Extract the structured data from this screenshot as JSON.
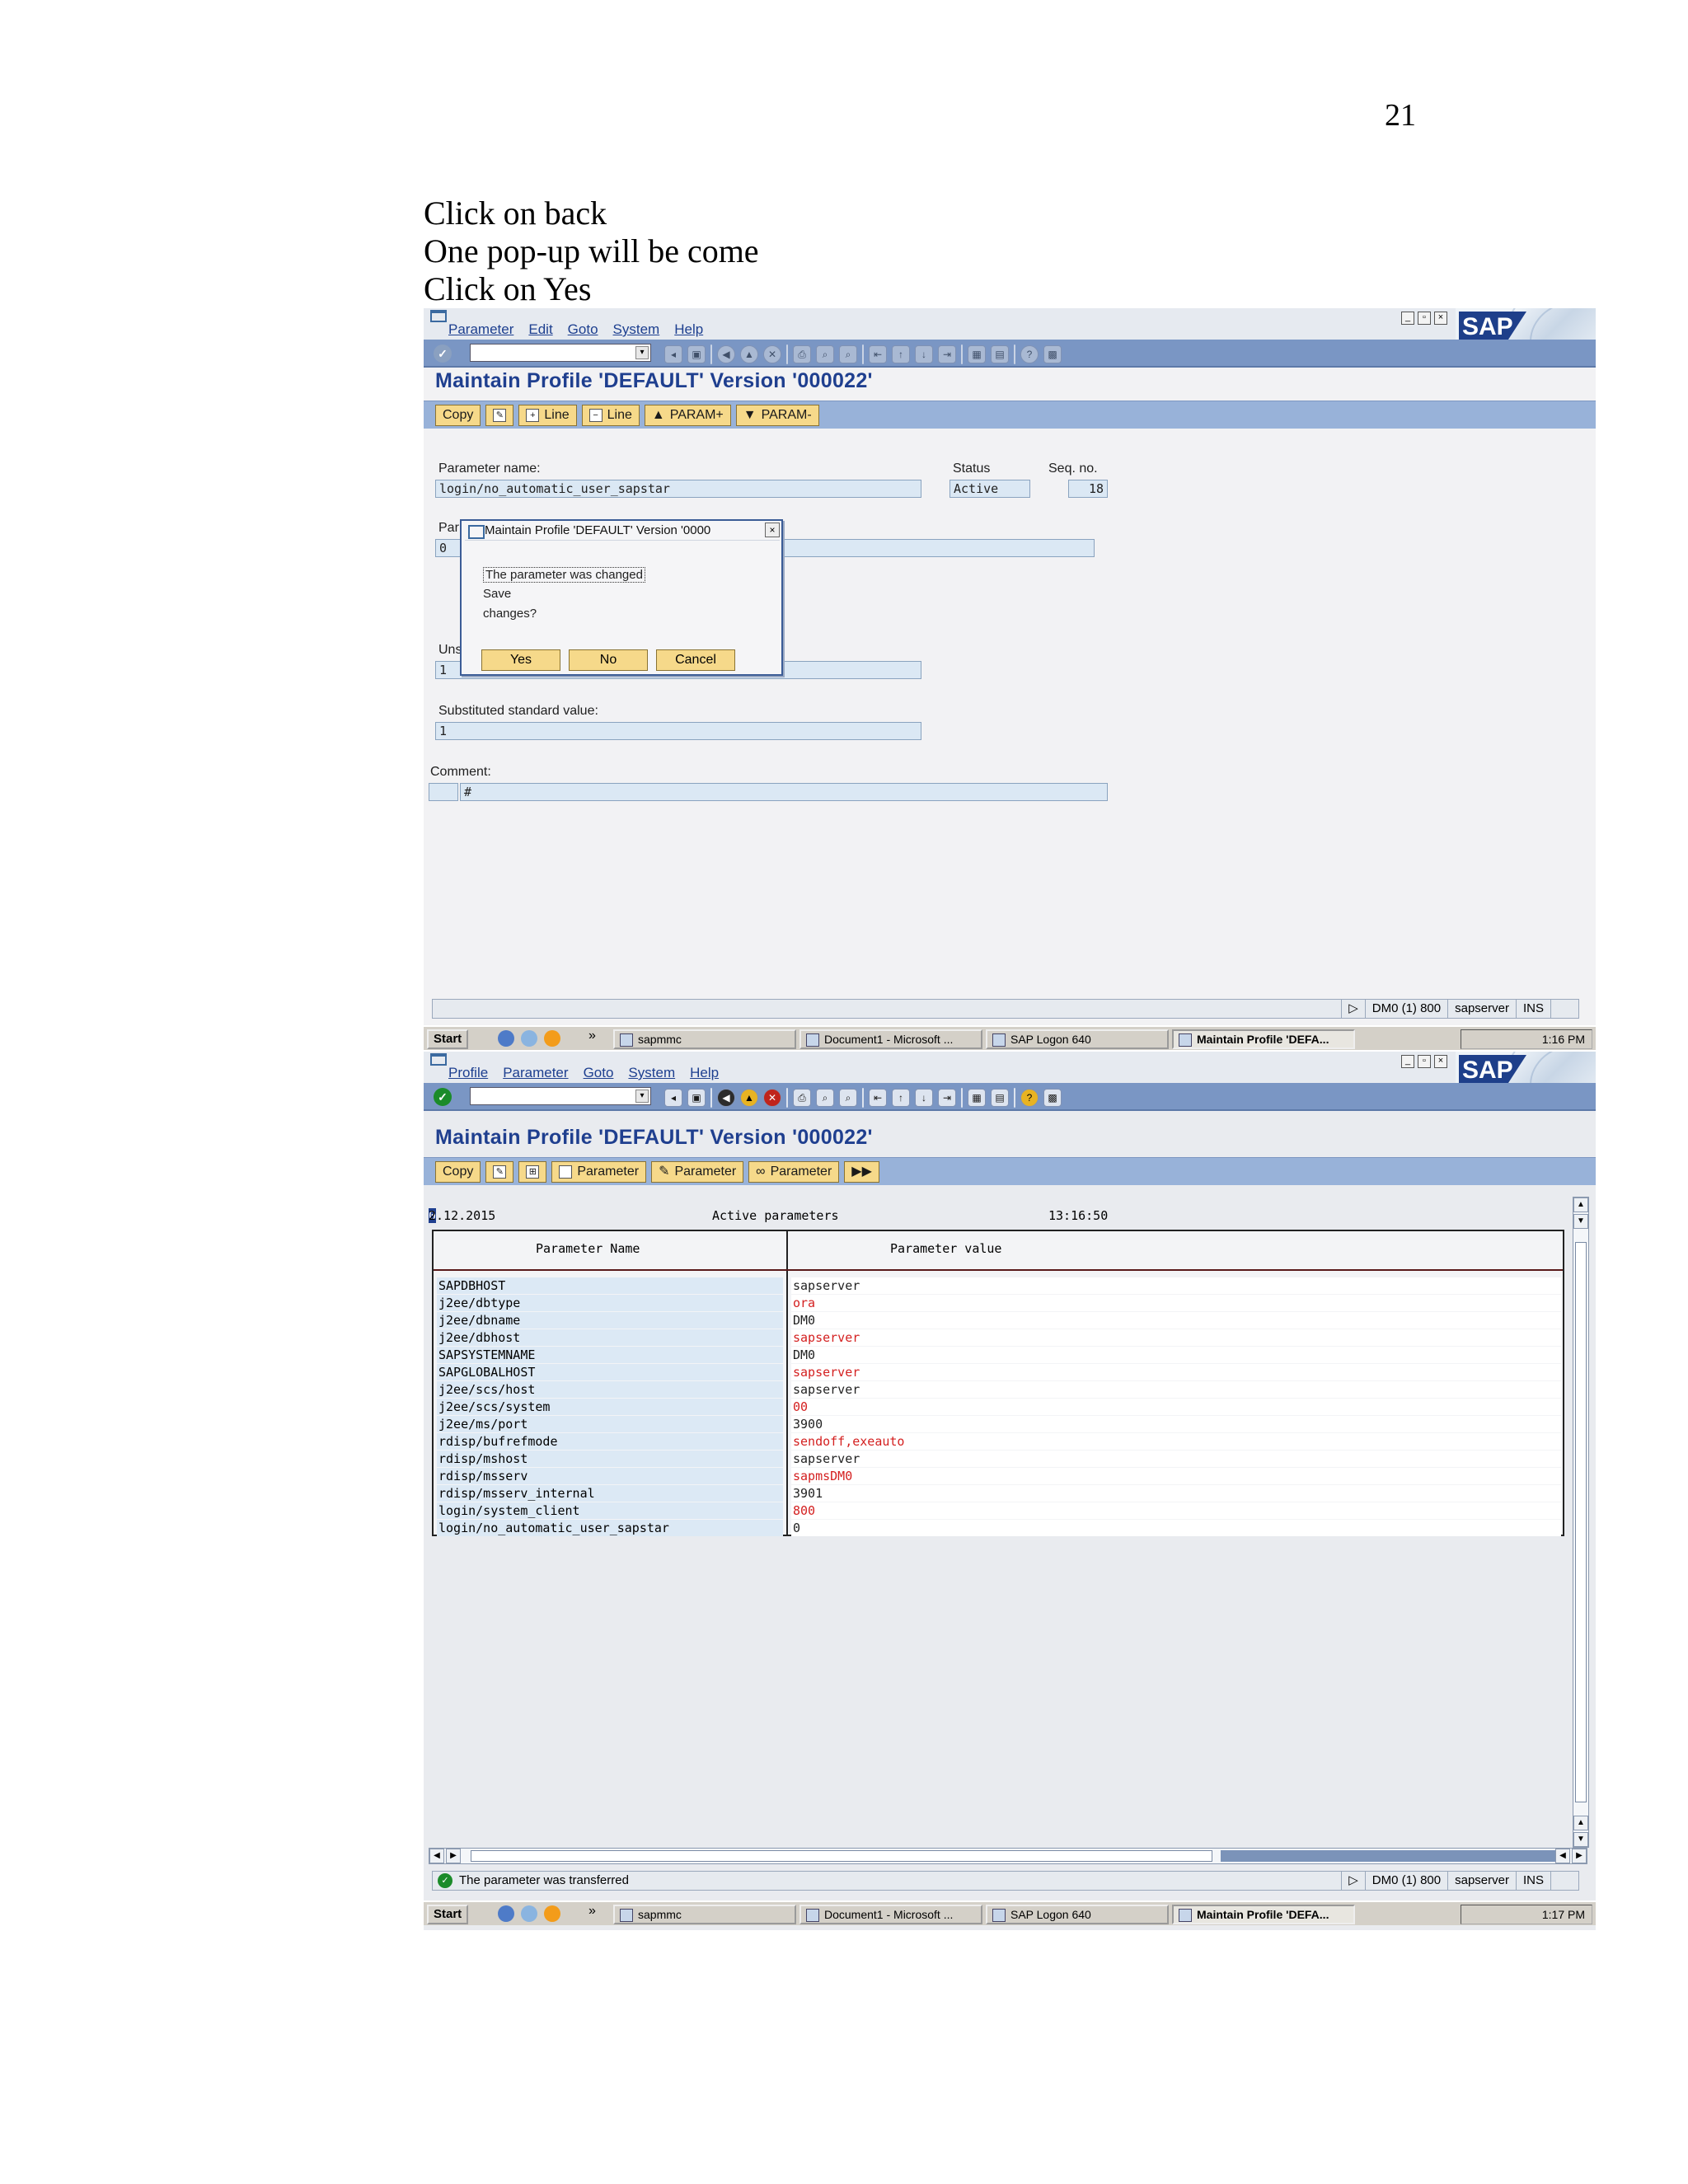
{
  "page_number": "21",
  "instructions": [
    "Click on back",
    "One pop-up will be come",
    "Click on Yes"
  ],
  "screen1": {
    "menu": [
      "Parameter",
      "Edit",
      "Goto",
      "System",
      "Help"
    ],
    "title": "Maintain Profile 'DEFAULT' Version '000022'",
    "buttons": [
      "Copy",
      "Line",
      "Line",
      "PARAM+",
      "PARAM-"
    ],
    "param_name_label": "Parameter name:",
    "param_name_value": "login/no_automatic_user_sapstar",
    "status_label": "Status",
    "status_value": "Active",
    "seq_label": "Seq. no.",
    "seq_value": "18",
    "param_value_label_partial": "Par",
    "param_value_value": "0",
    "unsub_label_partial": "Uns",
    "unsub_value": "1",
    "subst_label": "Substituted standard value:",
    "subst_value": "1",
    "comment_label": "Comment:",
    "comment_value": "#",
    "dialog": {
      "title": "Maintain Profile 'DEFAULT' Version '0000",
      "line1": "The parameter was changed",
      "line2": "Save",
      "line3": "changes?",
      "yes": "Yes",
      "no": "No",
      "cancel": "Cancel"
    },
    "status": {
      "system": "DM0 (1) 800",
      "server": "sapserver",
      "mode": "INS"
    },
    "taskbar": {
      "start": "Start",
      "tasks": [
        "sapmmc",
        "Document1 - Microsoft ...",
        "SAP Logon 640",
        "Maintain Profile 'DEFA..."
      ],
      "time": "1:16 PM"
    }
  },
  "screen2": {
    "menu": [
      "Profile",
      "Parameter",
      "Goto",
      "System",
      "Help"
    ],
    "title": "Maintain Profile 'DEFAULT' Version '000022'",
    "buttons": [
      "Copy",
      "Parameter",
      "Parameter",
      "Parameter"
    ],
    "report_date_cursor": "0",
    "report_date": "2.12.2015",
    "report_heading": "Active parameters",
    "report_time": "13:16:50",
    "col_name": "Parameter Name",
    "col_value": "Parameter value",
    "rows": [
      {
        "name": "SAPDBHOST",
        "value": "sapserver",
        "color": "#222222"
      },
      {
        "name": "j2ee/dbtype",
        "value": "ora",
        "color": "#d42020"
      },
      {
        "name": "j2ee/dbname",
        "value": "DM0",
        "color": "#222222"
      },
      {
        "name": "j2ee/dbhost",
        "value": "sapserver",
        "color": "#d42020"
      },
      {
        "name": "SAPSYSTEMNAME",
        "value": "DM0",
        "color": "#222222"
      },
      {
        "name": "SAPGLOBALHOST",
        "value": "sapserver",
        "color": "#d42020"
      },
      {
        "name": "j2ee/scs/host",
        "value": "sapserver",
        "color": "#222222"
      },
      {
        "name": "j2ee/scs/system",
        "value": "00",
        "color": "#d42020"
      },
      {
        "name": "j2ee/ms/port",
        "value": "3900",
        "color": "#222222"
      },
      {
        "name": "rdisp/bufrefmode",
        "value": "sendoff,exeauto",
        "color": "#d42020"
      },
      {
        "name": "rdisp/mshost",
        "value": "sapserver",
        "color": "#222222"
      },
      {
        "name": "rdisp/msserv",
        "value": "sapmsDM0",
        "color": "#d42020"
      },
      {
        "name": "rdisp/msserv_internal",
        "value": "3901",
        "color": "#222222"
      },
      {
        "name": "login/system_client",
        "value": "800",
        "color": "#d42020"
      },
      {
        "name": "login/no_automatic_user_sapstar",
        "value": "0",
        "color": "#222222"
      }
    ],
    "status_message": "The parameter was transferred",
    "status": {
      "system": "DM0 (1) 800",
      "server": "sapserver",
      "mode": "INS"
    },
    "taskbar": {
      "start": "Start",
      "tasks": [
        "sapmmc",
        "Document1 - Microsoft ...",
        "SAP Logon 640",
        "Maintain Profile 'DEFA..."
      ],
      "time": "1:17 PM"
    }
  }
}
